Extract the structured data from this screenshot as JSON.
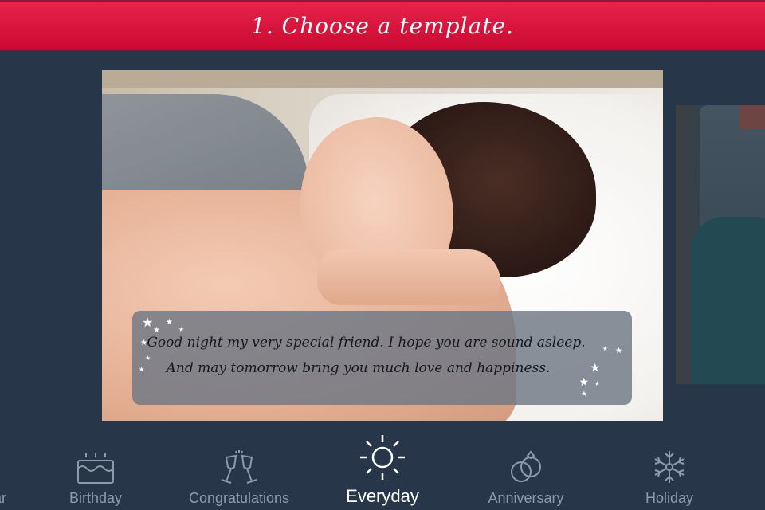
{
  "header": {
    "title": "1. Choose a template."
  },
  "template_card": {
    "message_lines": [
      "Good night my very special friend. I hope you are sound asleep.",
      "And may tomorrow bring you much love and happiness."
    ],
    "decoration_icons": [
      "star-icon",
      "crescent-moon-icon"
    ]
  },
  "colors": {
    "header_red": "#e11b42",
    "background_navy": "#28364a",
    "category_inactive": "#8e9bad",
    "category_active": "#ffffff",
    "moon_yellow": "#f5d916"
  },
  "categories": {
    "partial_label": "ar",
    "items": [
      {
        "label": "Birthday",
        "icon": "birthday-cake-icon",
        "active": false
      },
      {
        "label": "Congratulations",
        "icon": "champagne-glasses-icon",
        "active": false
      },
      {
        "label": "Everyday",
        "icon": "sun-icon",
        "active": true
      },
      {
        "label": "Anniversary",
        "icon": "wedding-rings-icon",
        "active": false
      },
      {
        "label": "Holiday",
        "icon": "snowflake-icon",
        "active": false
      }
    ]
  }
}
